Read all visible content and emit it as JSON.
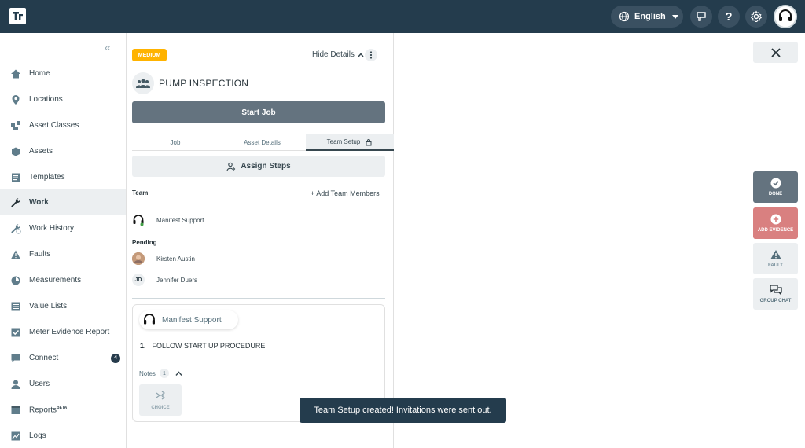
{
  "topbar": {
    "language": "English"
  },
  "sidebar": {
    "collapse_icon": "«",
    "items": [
      {
        "label": "Home",
        "icon": "home-icon"
      },
      {
        "label": "Locations",
        "icon": "location-pin-icon"
      },
      {
        "label": "Asset Classes",
        "icon": "asset-classes-icon"
      },
      {
        "label": "Assets",
        "icon": "cube-icon"
      },
      {
        "label": "Templates",
        "icon": "template-icon"
      },
      {
        "label": "Work",
        "icon": "wrench-icon",
        "active": true
      },
      {
        "label": "Work History",
        "icon": "work-history-icon"
      },
      {
        "label": "Faults",
        "icon": "warning-icon"
      },
      {
        "label": "Measurements",
        "icon": "gauge-icon"
      },
      {
        "label": "Value Lists",
        "icon": "list-icon"
      },
      {
        "label": "Meter Evidence Report",
        "icon": "checkbox-icon"
      },
      {
        "label": "Connect",
        "icon": "chat-icon",
        "badge": "4"
      },
      {
        "label": "Users",
        "icon": "user-icon"
      },
      {
        "label": "Reports",
        "icon": "reports-icon",
        "superscript": "BETA"
      },
      {
        "label": "Logs",
        "icon": "chart-line-icon"
      }
    ]
  },
  "job": {
    "priority": "MEDIUM",
    "hide_details": "Hide Details",
    "title": "PUMP INSPECTION",
    "start_job": "Start Job",
    "tabs": [
      "Job",
      "Asset Details",
      "Team Setup"
    ],
    "active_tab": "Team Setup",
    "assign_steps": "Assign Steps",
    "team_heading": "Team",
    "add_team_members": "+ Add Team Members",
    "team": [
      {
        "name": "Manifest Support"
      }
    ],
    "pending_heading": "Pending",
    "pending": [
      {
        "name": "Kirsten Austin"
      },
      {
        "name": "Jennifer Duers",
        "initials": "JD"
      }
    ],
    "step_card": {
      "assignee": "Manifest Support",
      "step_number": "1.",
      "step_text": "FOLLOW START UP PROCEDURE",
      "notes_label": "Notes",
      "notes_count": "1",
      "choice_label": "CHOICE"
    }
  },
  "actions": {
    "done": "DONE",
    "add_evidence": "ADD EVIDENCE",
    "fault": "FAULT",
    "group_chat": "GROUP CHAT"
  },
  "toast": "Team Setup created! Invitations were sent out.",
  "colors": {
    "topbar": "#243c4d",
    "priority_medium": "#ffb300",
    "start_job": "#64737f",
    "add_evidence": "#d98080"
  }
}
